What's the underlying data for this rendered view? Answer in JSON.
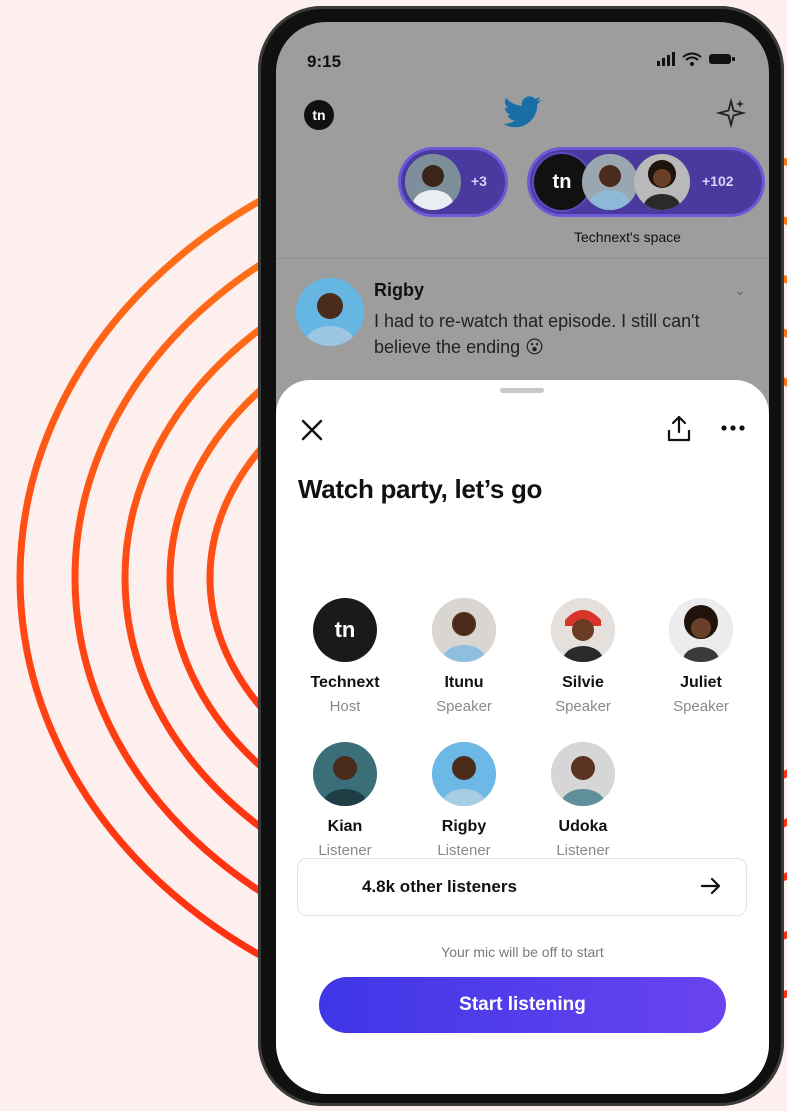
{
  "status": {
    "time": "9:15"
  },
  "top": {
    "logo_text": "tn",
    "spaces": [
      {
        "count": "+3"
      },
      {
        "logo_text": "tn",
        "count": "+102",
        "label": "Technext's space"
      }
    ]
  },
  "tweet": {
    "name": "Rigby",
    "text": "I had to re-watch that episode. I still can't believe the ending"
  },
  "sheet": {
    "title": "Watch party, let’s go",
    "participants": [
      {
        "name": "Technext",
        "role": "Host",
        "logo_text": "tn"
      },
      {
        "name": "Itunu",
        "role": "Speaker"
      },
      {
        "name": "Silvie",
        "role": "Speaker"
      },
      {
        "name": "Juliet",
        "role": "Speaker"
      },
      {
        "name": "Kian",
        "role": "Listener"
      },
      {
        "name": "Rigby",
        "role": "Listener"
      },
      {
        "name": "Udoka",
        "role": "Listener"
      }
    ],
    "other_listeners": "4.8k other listeners",
    "mic_note": "Your mic will be off to start",
    "start_button": "Start listening"
  },
  "colors": {
    "background": "#fcefed",
    "arc_orange": "#ff7a1a",
    "arc_red": "#ff2a10",
    "button_start": "#3e36e6",
    "button_end": "#6a44f0",
    "twitter_blue": "#1d9bf0"
  },
  "icons": [
    "signal-icon",
    "wifi-icon",
    "battery-icon",
    "twitter-bird-icon",
    "sparkle-icon",
    "close-icon",
    "share-icon",
    "more-icon",
    "arrow-right-icon"
  ]
}
